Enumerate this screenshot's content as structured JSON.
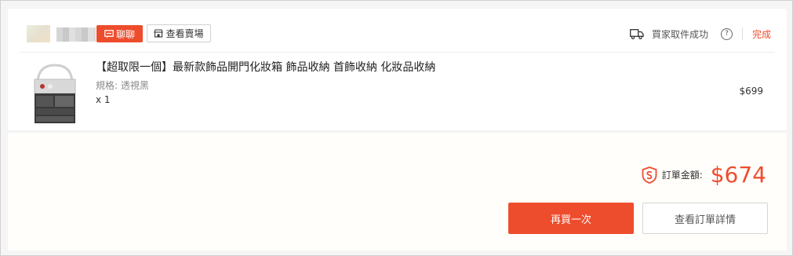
{
  "seller": {
    "chat_label": "聊聊",
    "shop_label": "查看賣場"
  },
  "order_status": {
    "label": "買家取件成功",
    "status": "完成"
  },
  "product": {
    "title": "【超取限一個】最新款飾品開門化妝箱 飾品收納 首飾收納 化妝品收納",
    "variant": "規格: 透視黑",
    "quantity": "x 1",
    "price": "$699"
  },
  "summary": {
    "total_label": "訂單金額:",
    "total_amount": "$674"
  },
  "actions": {
    "buy_again": "再買一次",
    "view_details": "查看訂單詳情"
  },
  "colors": {
    "accent": "#ee4d2d"
  },
  "icons": {
    "chat": "chat-icon",
    "shop": "shop-icon",
    "truck": "truck-icon",
    "help": "help-icon",
    "shield": "shield-icon"
  }
}
